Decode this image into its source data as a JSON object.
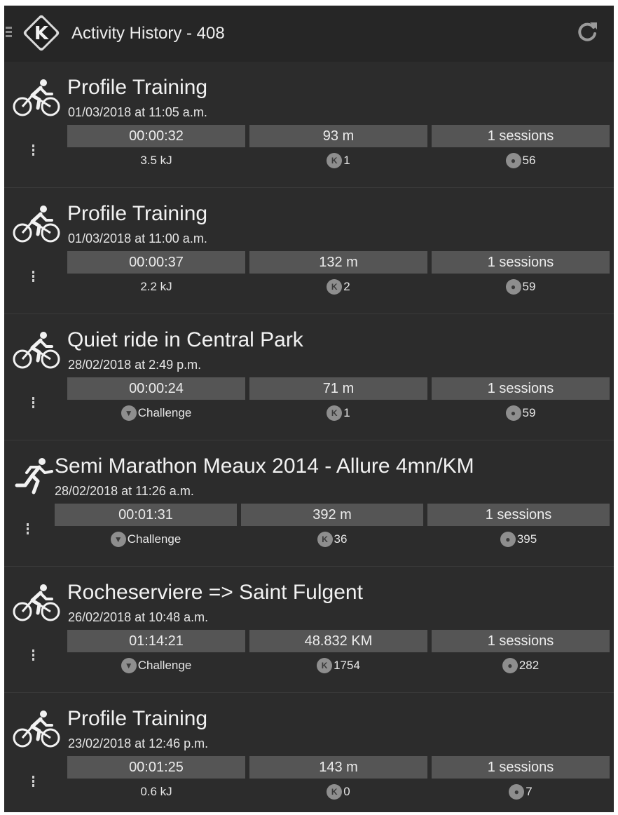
{
  "header": {
    "title": "Activity History - 408",
    "logo_letter": "K",
    "menu_icon": "hamburger-icon",
    "refresh_icon": "refresh-icon"
  },
  "colors": {
    "background": "#2c2c2c",
    "header": "#262626",
    "stat_cell": "#555555",
    "text": "#f2f2f2"
  },
  "activities": [
    {
      "icon": "cycling-icon",
      "title": "Profile Training",
      "date": "01/03/2018 at 11:05 a.m.",
      "duration": "00:00:32",
      "distance": "93 m",
      "sessions": "1 sessions",
      "energy_or_challenge": "3.5 kJ",
      "k_value": "1",
      "points": "56"
    },
    {
      "icon": "cycling-icon",
      "title": "Profile Training",
      "date": "01/03/2018 at 11:00 a.m.",
      "duration": "00:00:37",
      "distance": "132 m",
      "sessions": "1 sessions",
      "energy_or_challenge": "2.2 kJ",
      "k_value": "2",
      "points": "59"
    },
    {
      "icon": "cycling-icon",
      "title": "Quiet ride in Central Park",
      "date": "28/02/2018 at 2:49 p.m.",
      "duration": "00:00:24",
      "distance": "71 m",
      "sessions": "1 sessions",
      "energy_or_challenge": "Challenge",
      "k_value": "1",
      "points": "59"
    },
    {
      "icon": "running-icon",
      "title": "Semi Marathon Meaux 2014 - Allure 4mn/KM",
      "date": "28/02/2018 at 11:26 a.m.",
      "duration": "00:01:31",
      "distance": "392 m",
      "sessions": "1 sessions",
      "energy_or_challenge": "Challenge",
      "k_value": "36",
      "points": "395"
    },
    {
      "icon": "cycling-icon",
      "title": "Rocheserviere => Saint Fulgent",
      "date": "26/02/2018 at 10:48 a.m.",
      "duration": "01:14:21",
      "distance": "48.832 KM",
      "sessions": "1 sessions",
      "energy_or_challenge": "Challenge",
      "k_value": "1754",
      "points": "282"
    },
    {
      "icon": "cycling-icon",
      "title": "Profile Training",
      "date": "23/02/2018 at 12:46 p.m.",
      "duration": "00:01:25",
      "distance": "143 m",
      "sessions": "1 sessions",
      "energy_or_challenge": "0.6 kJ",
      "k_value": "0",
      "points": "7"
    }
  ]
}
